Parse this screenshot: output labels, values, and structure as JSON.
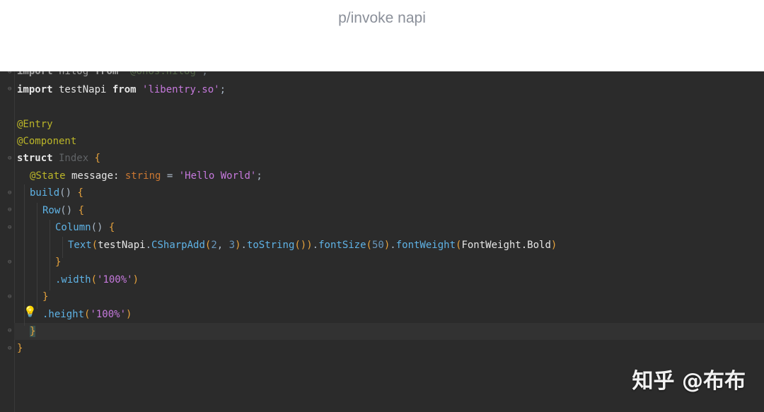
{
  "caption": {
    "text": "p/invoke napi"
  },
  "code": {
    "l0": {
      "kw": "import",
      "name": " hilog ",
      "from": "from",
      "str": " '@ohos.hilog'",
      "end": ";"
    },
    "l1": {
      "kw": "import",
      "name": " testNapi ",
      "from": "from",
      "str": " 'libentry.so'",
      "end": ";"
    },
    "l3": {
      "ann": "@Entry"
    },
    "l4": {
      "ann": "@Component"
    },
    "l5": {
      "kw": "struct",
      "name": " Index ",
      "brace": "{"
    },
    "l6": {
      "ann": "@State",
      "rest": " message: ",
      "type": "string",
      "eq": " = ",
      "str": "'Hello World'",
      "end": ";"
    },
    "l7": {
      "fn": "build",
      "paren": "() ",
      "brace": "{"
    },
    "l8": {
      "fn": "Row",
      "paren": "() ",
      "brace": "{"
    },
    "l9": {
      "fn": "Column",
      "paren": "() ",
      "brace": "{"
    },
    "l10": {
      "fn": "Text",
      "p1": "(",
      "obj": "testNapi",
      "dot1": ".",
      "m1": "CSharpAdd",
      "p2": "(",
      "n1": "2",
      "comma": ", ",
      "n2": "3",
      "p3": ")",
      "dot2": ".",
      "m2": "toString",
      "p4": "())",
      "dot3": ".",
      "m3": "fontSize",
      "p5": "(",
      "n3": "50",
      "p6": ")",
      "dot4": ".",
      "m4": "fontWeight",
      "p7": "(",
      "arg": "FontWeight.Bold",
      "p8": ")"
    },
    "l11": {
      "brace": "}"
    },
    "l12": {
      "m": ".width",
      "p1": "(",
      "str": "'100%'",
      "p2": ")"
    },
    "l13": {
      "brace": "}"
    },
    "l14": {
      "m": ".height",
      "p1": "(",
      "str": "'100%'",
      "p2": ")"
    },
    "l15": {
      "brace": "}"
    },
    "l16": {
      "brace": "}"
    }
  },
  "watermark": {
    "text": "知乎 @布布"
  },
  "colors": {
    "editor_bg": "#2b2b2b",
    "keyword": "#cc7832",
    "string": "#6a8759",
    "annotation": "#bbb529",
    "number": "#6897bb"
  }
}
